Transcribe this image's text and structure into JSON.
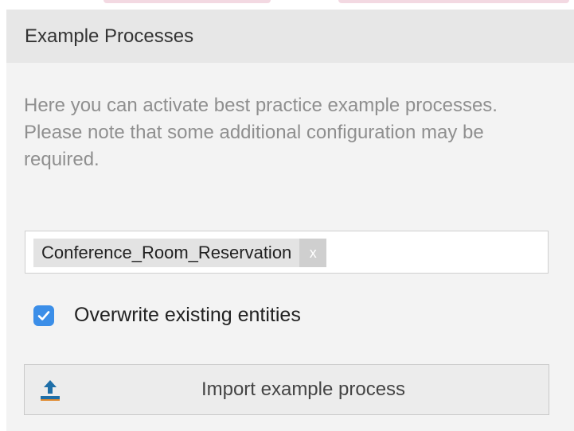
{
  "panel": {
    "title": "Example Processes",
    "description": "Here you can activate best practice example processes. Please note that some additional configuration may be required."
  },
  "process_select": {
    "selected_tag": "Conference_Room_Reservation",
    "remove_label": "x"
  },
  "overwrite_option": {
    "label": "Overwrite existing entities",
    "checked": true
  },
  "import_button": {
    "label": "Import example process",
    "icon": "upload-icon"
  },
  "colors": {
    "accent": "#3b8ee8",
    "icon": "#1f6fa8",
    "panel_bg": "#f3f3f3",
    "header_bg": "#e7e7e7"
  }
}
